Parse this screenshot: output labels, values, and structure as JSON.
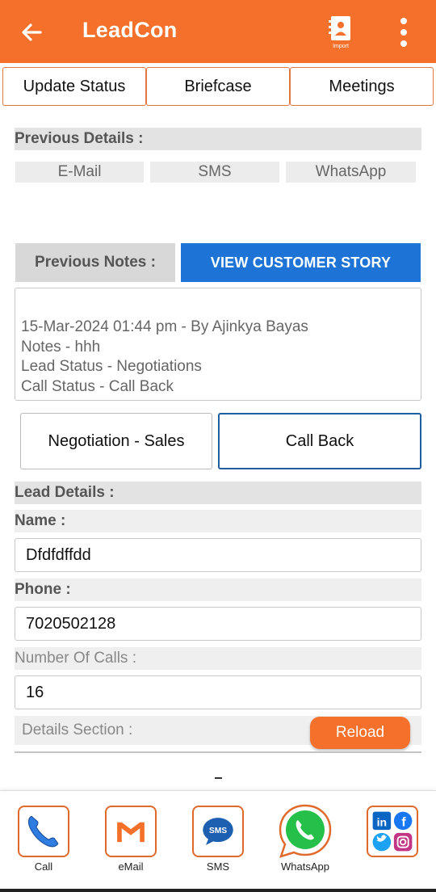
{
  "appbar": {
    "title": "LeadCon",
    "import_label": "Import"
  },
  "tabs": [
    "Update Status",
    "Briefcase",
    "Meetings"
  ],
  "previous_details": {
    "header": "Previous Details :",
    "chips": [
      "E-Mail",
      "SMS",
      "WhatsApp"
    ]
  },
  "notes": {
    "label": "Previous Notes :",
    "story_button": "VIEW CUSTOMER STORY",
    "lines": [
      "15-Mar-2024 01:44 pm - By Ajinkya Bayas",
      "Notes - hhh",
      "Lead Status - Negotiations",
      "Call Status - Call Back"
    ]
  },
  "status": {
    "lead_status": "Negotiation - Sales",
    "call_status": "Call Back"
  },
  "lead_details": {
    "header": "Lead Details :",
    "name_label": "Name :",
    "name_value": "Dfdfdffdd",
    "phone_label": "Phone :",
    "phone_value": "7020502128",
    "calls_label": "Number Of Calls :",
    "calls_value": "16",
    "details_label": "Details Section :",
    "reload_button": "Reload"
  },
  "bottom_nav": [
    {
      "label": "Call",
      "icon": "phone-icon"
    },
    {
      "label": "eMail",
      "icon": "gmail-icon"
    },
    {
      "label": "SMS",
      "icon": "sms-icon"
    },
    {
      "label": "WhatsApp",
      "icon": "whatsapp-icon"
    },
    {
      "label": "",
      "icon": "social-icon"
    }
  ],
  "colors": {
    "primary": "#f5702a",
    "accent_blue": "#1e73d6",
    "selected_border": "#1f5f9e"
  }
}
